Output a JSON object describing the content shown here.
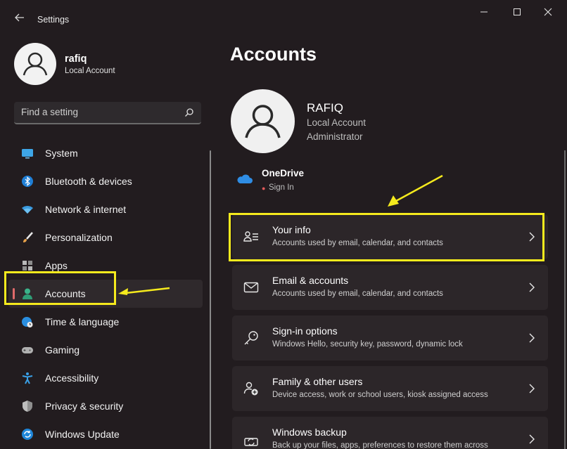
{
  "window": {
    "title": "Settings",
    "back_icon": "back-arrow-icon",
    "controls": [
      "minimize-icon",
      "maximize-icon",
      "close-icon"
    ]
  },
  "profile": {
    "name": "rafiq",
    "account_type": "Local Account"
  },
  "search": {
    "placeholder": "Find a setting"
  },
  "sidebar": {
    "items": [
      {
        "label": "System",
        "icon": "monitor-icon"
      },
      {
        "label": "Bluetooth & devices",
        "icon": "bluetooth-icon"
      },
      {
        "label": "Network & internet",
        "icon": "wifi-icon"
      },
      {
        "label": "Personalization",
        "icon": "brush-icon"
      },
      {
        "label": "Apps",
        "icon": "apps-icon"
      },
      {
        "label": "Accounts",
        "icon": "person-icon",
        "active": true
      },
      {
        "label": "Time & language",
        "icon": "globe-clock-icon"
      },
      {
        "label": "Gaming",
        "icon": "gamepad-icon"
      },
      {
        "label": "Accessibility",
        "icon": "accessibility-icon"
      },
      {
        "label": "Privacy & security",
        "icon": "shield-icon"
      },
      {
        "label": "Windows Update",
        "icon": "update-icon"
      }
    ]
  },
  "main": {
    "title": "Accounts",
    "user": {
      "name": "RAFIQ",
      "account_type": "Local Account",
      "role": "Administrator"
    },
    "onedrive": {
      "title": "OneDrive",
      "status": "Sign In"
    },
    "cards": [
      {
        "title": "Your info",
        "subtitle": "Accounts used by email, calendar, and contacts",
        "icon": "person-list-icon"
      },
      {
        "title": "Email & accounts",
        "subtitle": "Accounts used by email, calendar, and contacts",
        "icon": "mail-icon"
      },
      {
        "title": "Sign-in options",
        "subtitle": "Windows Hello, security key, password, dynamic lock",
        "icon": "key-icon"
      },
      {
        "title": "Family & other users",
        "subtitle": "Device access, work or school users, kiosk assigned access",
        "icon": "people-add-icon"
      },
      {
        "title": "Windows backup",
        "subtitle": "Back up your files, apps, preferences to restore them across",
        "icon": "backup-icon"
      }
    ]
  },
  "colors": {
    "background": "#221c1f",
    "card": "#2c2629",
    "highlight": "#f5ea1d",
    "accent": "#e06a6a"
  }
}
